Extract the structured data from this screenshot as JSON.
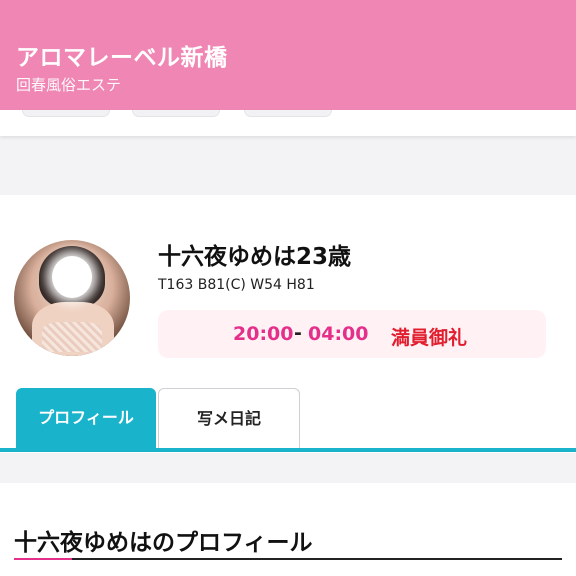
{
  "header": {
    "shop_name": "アロマレーベル新橋",
    "category": "回春風俗エステ"
  },
  "cast": {
    "name": "十六夜ゆめは23歳",
    "measurements": "T163 B81(C) W54 H81",
    "schedule": {
      "start": "20:00",
      "separator": "-",
      "end": "04:00",
      "status": "満員御礼"
    }
  },
  "tabs": [
    {
      "label": "プロフィール",
      "active": true
    },
    {
      "label": "写メ日記",
      "active": false
    }
  ],
  "section": {
    "title": "十六夜ゆめはのプロフィール"
  },
  "colors": {
    "header_bg": "#ef86b4",
    "accent_tab": "#19b3cb",
    "time_color": "#e4308a",
    "status_color": "#e11d2e",
    "schedule_bg": "#fff1f4"
  }
}
